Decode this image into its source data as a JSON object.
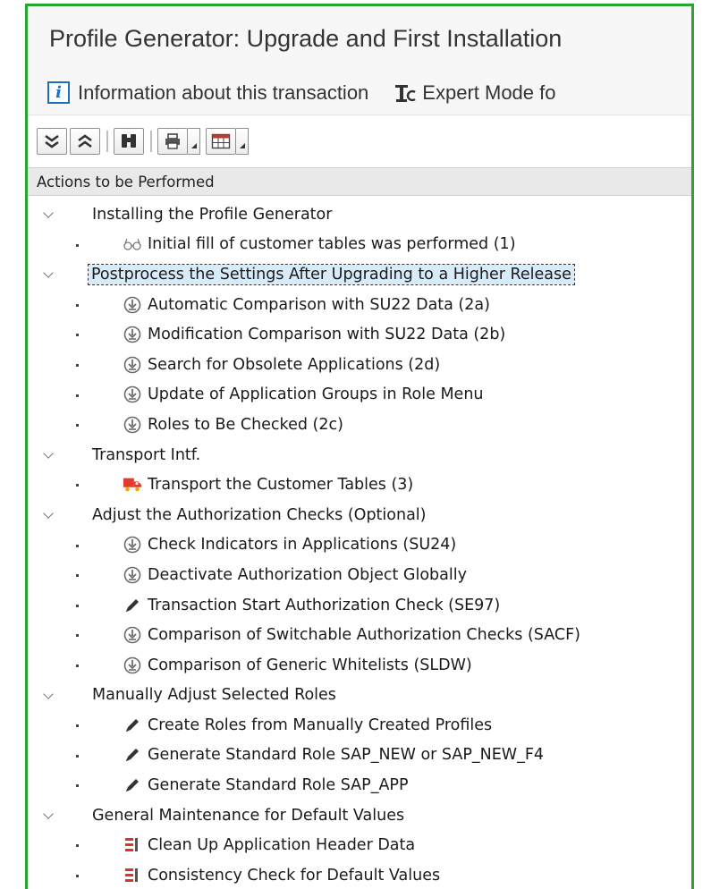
{
  "window": {
    "title": "Profile Generator: Upgrade and First Installation"
  },
  "appbar": {
    "info_label": "Information about this transaction",
    "expert_label": "Expert Mode fo"
  },
  "toolbar": {
    "buttons": [
      "expand-all-icon",
      "collapse-all-icon",
      "find-icon",
      "print-icon",
      "layout-icon"
    ]
  },
  "tree": {
    "header": "Actions to be Performed",
    "sections": [
      {
        "label": "Installing the Profile Generator",
        "items": [
          {
            "label": "Initial fill of customer tables was performed (1)",
            "icon": "glasses-icon"
          }
        ]
      },
      {
        "label": "Postprocess the Settings After Upgrading to a Higher Release",
        "selected": true,
        "items": [
          {
            "label": "Automatic Comparison with SU22 Data (2a)",
            "icon": "execute-icon"
          },
          {
            "label": "Modification Comparison with SU22 Data (2b)",
            "icon": "execute-icon"
          },
          {
            "label": "Search for Obsolete Applications (2d)",
            "icon": "execute-icon"
          },
          {
            "label": "Update of Application Groups in Role Menu",
            "icon": "execute-icon"
          },
          {
            "label": "Roles to Be Checked (2c)",
            "icon": "execute-icon"
          }
        ]
      },
      {
        "label": "Transport Intf.",
        "items": [
          {
            "label": "Transport the Customer Tables (3)",
            "icon": "truck-icon"
          }
        ]
      },
      {
        "label": "Adjust the Authorization Checks (Optional)",
        "items": [
          {
            "label": "Check Indicators in Applications (SU24)",
            "icon": "execute-icon"
          },
          {
            "label": "Deactivate Authorization Object Globally",
            "icon": "execute-icon"
          },
          {
            "label": "Transaction Start Authorization Check (SE97)",
            "icon": "pencil-icon"
          },
          {
            "label": "Comparison of Switchable Authorization Checks (SACF)",
            "icon": "execute-icon"
          },
          {
            "label": "Comparison of Generic Whitelists (SLDW)",
            "icon": "execute-icon"
          }
        ]
      },
      {
        "label": "Manually Adjust Selected Roles",
        "items": [
          {
            "label": "Create Roles from Manually Created Profiles",
            "icon": "pencil-icon"
          },
          {
            "label": "Generate Standard Role SAP_NEW or SAP_NEW_F4",
            "icon": "pencil-icon"
          },
          {
            "label": "Generate Standard Role SAP_APP",
            "icon": "pencil-icon"
          }
        ]
      },
      {
        "label": "General Maintenance for Default Values",
        "items": [
          {
            "label": "Clean Up Application Header Data",
            "icon": "list-icon"
          },
          {
            "label": "Consistency Check for Default Values",
            "icon": "list-icon"
          }
        ]
      }
    ]
  },
  "colors": {
    "frame_border": "#2aa630",
    "selection_bg": "#d8ebf9",
    "icon_gray": "#6b6b6b",
    "icon_red": "#d9342b"
  }
}
